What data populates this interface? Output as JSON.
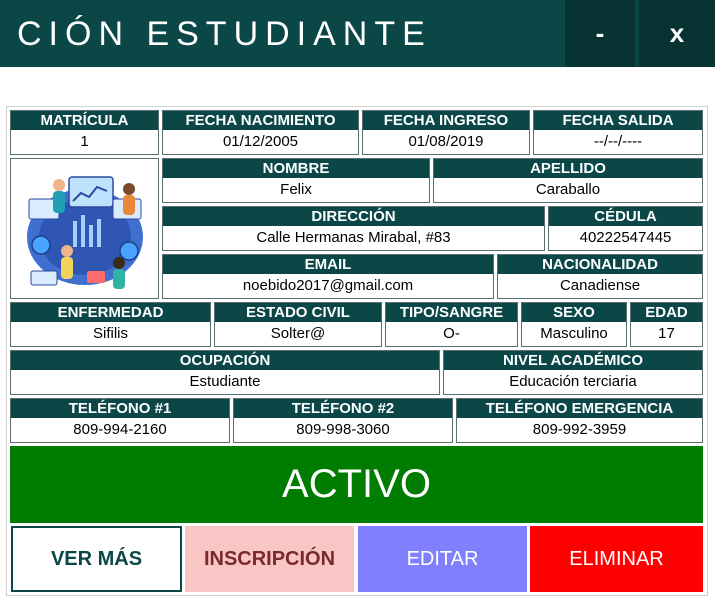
{
  "window": {
    "title": "CIÓN ESTUDIANTE",
    "minimize_label": "-",
    "close_label": "x"
  },
  "fields": {
    "matricula": {
      "label": "MATRÍCULA",
      "value": "1"
    },
    "fecha_nacimiento": {
      "label": "FECHA NACIMIENTO",
      "value": "01/12/2005"
    },
    "fecha_ingreso": {
      "label": "FECHA INGRESO",
      "value": "01/08/2019"
    },
    "fecha_salida": {
      "label": "FECHA SALIDA",
      "value": "--/--/----"
    },
    "nombre": {
      "label": "NOMBRE",
      "value": "Felix"
    },
    "apellido": {
      "label": "APELLIDO",
      "value": "Caraballo"
    },
    "direccion": {
      "label": "DIRECCIÓN",
      "value": "Calle Hermanas Mirabal, #83"
    },
    "cedula": {
      "label": "CÉDULA",
      "value": "40222547445"
    },
    "email": {
      "label": "EMAIL",
      "value": "noebido2017@gmail.com"
    },
    "nacionalidad": {
      "label": "NACIONALIDAD",
      "value": "Canadiense"
    },
    "enfermedad": {
      "label": "ENFERMEDAD",
      "value": "Sifilis"
    },
    "estado_civil": {
      "label": "ESTADO CIVIL",
      "value": "Solter@"
    },
    "tipo_sangre": {
      "label": "TIPO/SANGRE",
      "value": "O-"
    },
    "sexo": {
      "label": "SEXO",
      "value": "Masculino"
    },
    "edad": {
      "label": "EDAD",
      "value": "17"
    },
    "ocupacion": {
      "label": "OCUPACIÓN",
      "value": "Estudiante"
    },
    "nivel_academico": {
      "label": "NIVEL ACADÉMICO",
      "value": "Educación terciaria"
    },
    "telefono1": {
      "label": "TELÉFONO #1",
      "value": "809-994-2160"
    },
    "telefono2": {
      "label": "TELÉFONO #2",
      "value": "809-998-3060"
    },
    "telefono_emergencia": {
      "label": "TELÉFONO EMERGENCIA",
      "value": "809-992-3959"
    }
  },
  "status": {
    "label": "ACTIVO",
    "color": "#007c00"
  },
  "actions": {
    "ver_mas": {
      "label": "VER MÁS",
      "bg": "#ffffff",
      "fg": "#0b4747"
    },
    "inscripcion": {
      "label": "INSCRIPCIÓN",
      "bg": "#f9c5c5",
      "fg": "#7a2a2a"
    },
    "editar": {
      "label": "EDITAR",
      "bg": "#8080ff",
      "fg": "#ffffff"
    },
    "eliminar": {
      "label": "ELIMINAR",
      "bg": "#ff0000",
      "fg": "#ffffff"
    }
  },
  "colors": {
    "header": "#0b4747",
    "header_button": "#073333"
  },
  "photo": {
    "icon": "student-illustration-icon"
  }
}
